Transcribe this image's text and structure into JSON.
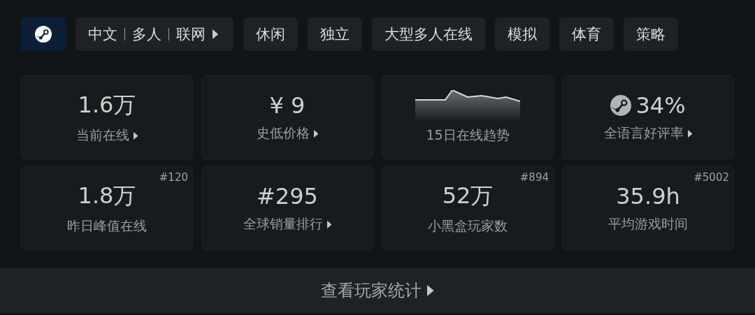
{
  "tags_bar": {
    "compound_tag": {
      "parts": [
        "中文",
        "多人",
        "联网"
      ]
    },
    "tags": [
      "休闲",
      "独立",
      "大型多人在线",
      "模拟",
      "体育",
      "策略"
    ]
  },
  "stats": [
    {
      "kind": "number",
      "value": "1.6万",
      "label": "当前在线",
      "link": true
    },
    {
      "kind": "number",
      "value": "¥ 9",
      "label": "史低价格",
      "link": true
    },
    {
      "kind": "sparkline",
      "label": "15日在线趋势",
      "link": false
    },
    {
      "kind": "rating",
      "value": "34%",
      "label": "全语言好评率",
      "link": true
    },
    {
      "kind": "number",
      "value": "1.8万",
      "label": "昨日峰值在线",
      "rank": "#120",
      "link": false
    },
    {
      "kind": "number",
      "value": "#295",
      "label": "全球销量排行",
      "link": true
    },
    {
      "kind": "number",
      "value": "52万",
      "label": "小黑盒玩家数",
      "rank": "#894",
      "link": false
    },
    {
      "kind": "number",
      "value": "35.9h",
      "label": "平均游戏时间",
      "rank": "#5002",
      "link": false
    }
  ],
  "footer": {
    "label": "查看玩家统计"
  }
}
